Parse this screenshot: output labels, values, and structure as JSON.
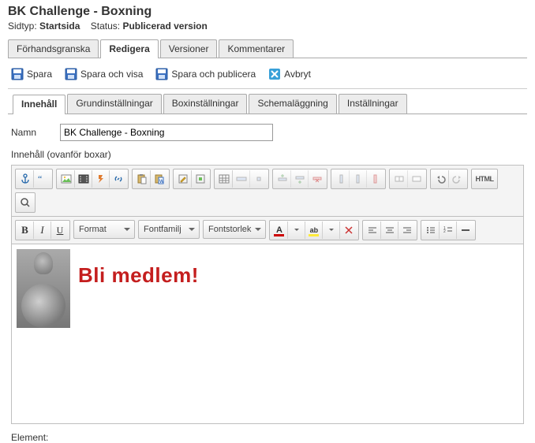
{
  "header": {
    "title": "BK Challenge - Boxning",
    "meta_pagetype_label": "Sidtyp:",
    "meta_pagetype_value": "Startsida",
    "meta_status_label": "Status:",
    "meta_status_value": "Publicerad version"
  },
  "tabs": {
    "main": [
      {
        "label": "Förhandsgranska",
        "active": false
      },
      {
        "label": "Redigera",
        "active": true
      },
      {
        "label": "Versioner",
        "active": false
      },
      {
        "label": "Kommentarer",
        "active": false
      }
    ],
    "sub": [
      {
        "label": "Innehåll",
        "active": true
      },
      {
        "label": "Grundinställningar",
        "active": false
      },
      {
        "label": "Boxinställningar",
        "active": false
      },
      {
        "label": "Schemaläggning",
        "active": false
      },
      {
        "label": "Inställningar",
        "active": false
      }
    ]
  },
  "actions": {
    "save": "Spara",
    "save_show": "Spara och visa",
    "save_publish": "Spara och publicera",
    "cancel": "Avbryt"
  },
  "form": {
    "name_label": "Namn",
    "name_value": "BK Challenge - Boxning",
    "content_above_label": "Innehåll (ovanför boxar)"
  },
  "editor": {
    "format_label": "Format",
    "fontfamily_label": "Fontfamilj",
    "fontsize_label": "Fontstorlek",
    "html_label": "HTML"
  },
  "canvas": {
    "headline": "Bli medlem!"
  },
  "footer": {
    "element_label": "Element:"
  }
}
